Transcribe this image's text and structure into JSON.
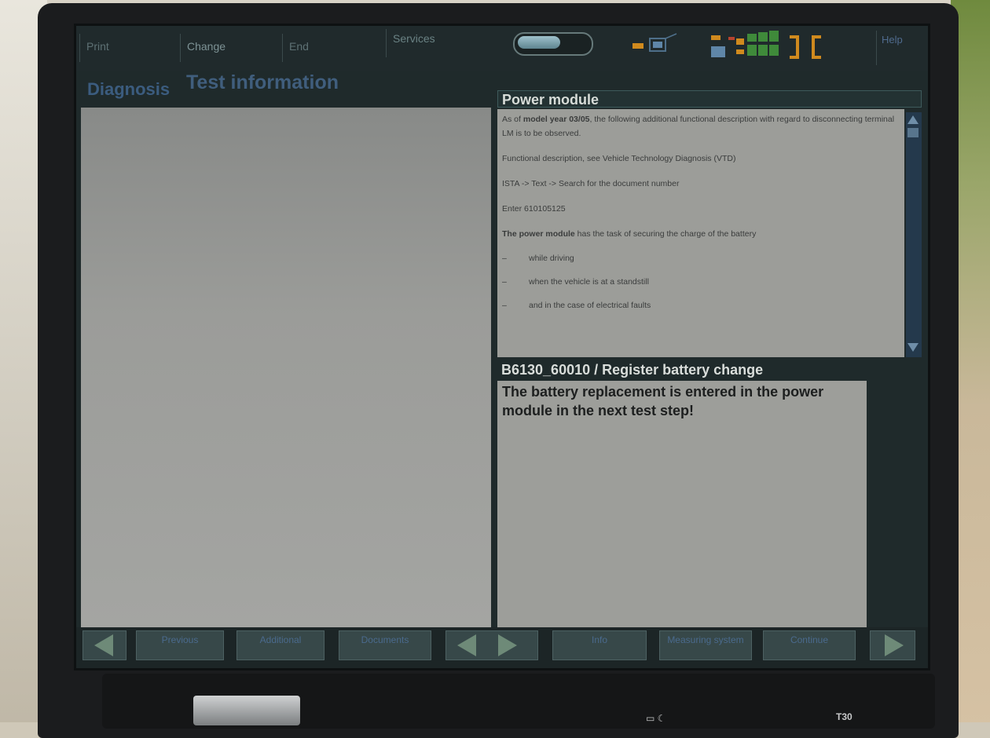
{
  "menu": {
    "items": [
      "Print",
      "Change",
      "End",
      "Services"
    ],
    "help_label": "Help"
  },
  "header": {
    "tab_diagnosis": "Diagnosis",
    "tab_test_info": "Test information"
  },
  "power_module": {
    "title": "Power module",
    "para1_pre": "As of ",
    "para1_bold": "model year 03/05",
    "para1_post": ", the following additional functional description with regard to disconnecting terminal LM is to be observed.",
    "para2": "Functional description, see Vehicle Technology Diagnosis (VTD)",
    "para3": "ISTA -> Text -> Search for the document number",
    "para4": "Enter 610105125",
    "para5_bold": "The power module",
    "para5_post": " has the task of securing the charge of the battery",
    "bullets": [
      "while driving",
      "when the vehicle is at a standstill",
      "and in the case of electrical faults"
    ],
    "bullet_dash": "–"
  },
  "test_step": {
    "title": "B6130_60010 / Register battery change",
    "message": "The battery replacement is entered in the power module in the next test step!"
  },
  "buttons": [
    "Previous",
    "Additional",
    "Documents",
    "Info",
    "Measuring system",
    "Continue"
  ],
  "laptop": {
    "model_label": "T30",
    "indicator_label": "▭ ☾"
  },
  "colors": {
    "screen_bg": "#1f2a2b",
    "content_gray": "#9c9d99",
    "header_blue": "#405e7d",
    "status_green": "#3f8a3a",
    "status_orange": "#d08a1e"
  }
}
